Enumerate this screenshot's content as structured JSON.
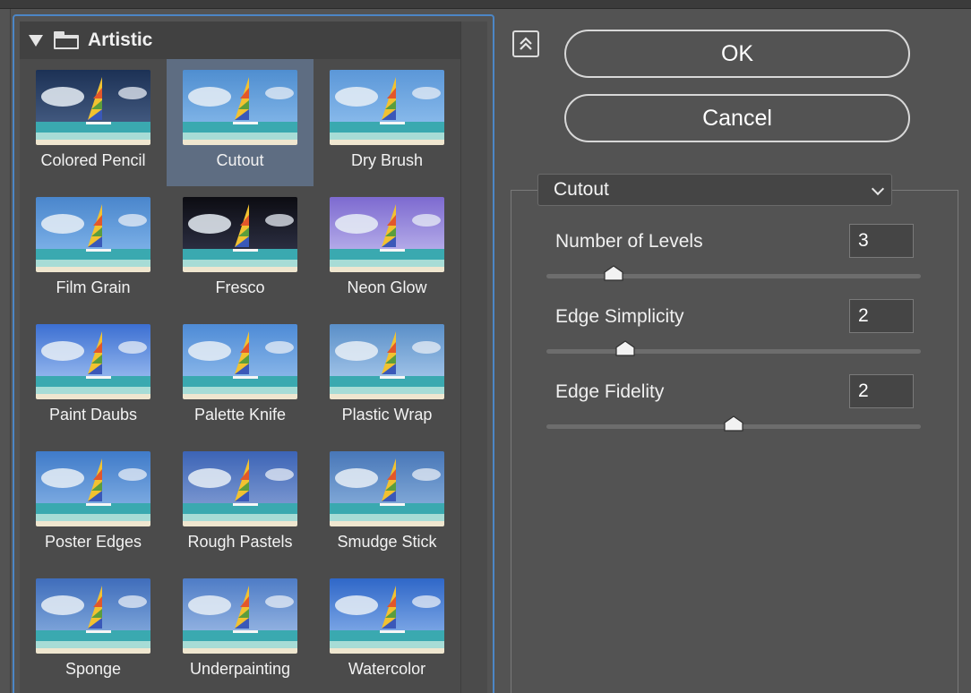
{
  "gallery": {
    "category": "Artistic",
    "selected_index": 1,
    "filters": [
      {
        "label": "Colored Pencil"
      },
      {
        "label": "Cutout"
      },
      {
        "label": "Dry Brush"
      },
      {
        "label": "Film Grain"
      },
      {
        "label": "Fresco"
      },
      {
        "label": "Neon Glow"
      },
      {
        "label": "Paint Daubs"
      },
      {
        "label": "Palette Knife"
      },
      {
        "label": "Plastic Wrap"
      },
      {
        "label": "Poster Edges"
      },
      {
        "label": "Rough Pastels"
      },
      {
        "label": "Smudge Stick"
      },
      {
        "label": "Sponge"
      },
      {
        "label": "Underpainting"
      },
      {
        "label": "Watercolor"
      }
    ]
  },
  "buttons": {
    "ok_label": "OK",
    "cancel_label": "Cancel"
  },
  "settings": {
    "filter_select": "Cutout",
    "params": [
      {
        "label": "Number of Levels",
        "value": "3",
        "slider_fraction": 0.18
      },
      {
        "label": "Edge Simplicity",
        "value": "2",
        "slider_fraction": 0.21
      },
      {
        "label": "Edge Fidelity",
        "value": "2",
        "slider_fraction": 0.5
      }
    ]
  },
  "icons": {
    "collapse": "double-chevron-up-icon",
    "folder": "folder-icon",
    "disclosure": "triangle-down-icon",
    "dropdown": "chevron-down-icon"
  },
  "colors": {
    "panel_bg": "#535353",
    "selection": "#5e6d82",
    "focus_border": "#4c86c6"
  }
}
